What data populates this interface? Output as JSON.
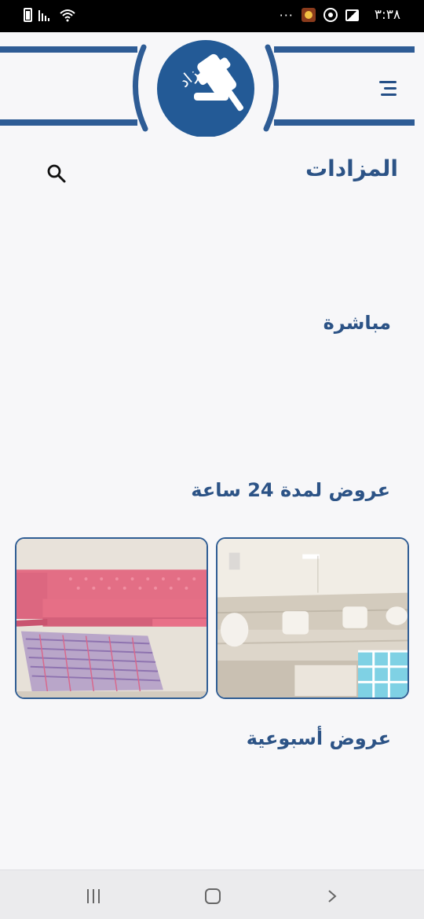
{
  "status_bar": {
    "time": "٣:٣٨",
    "more": "···",
    "icons": [
      "battery-icon",
      "signal-icon",
      "wifi-icon",
      "app-notification-icon",
      "whatsapp-icon",
      "gallery-icon"
    ]
  },
  "header": {
    "logo_text": "مزاد",
    "brand_color": "#2e5c95",
    "icons": [
      "gavel-logo-icon",
      "menu-icon"
    ]
  },
  "page": {
    "title": "المزادات",
    "search_icon": "search-icon"
  },
  "sections": {
    "live": "مباشرة",
    "offers_24h": "عروض لمدة 24 ساعة",
    "weekly": "عروض أسبوعية"
  },
  "cards": [
    {
      "image": "beige-sofa-living-room"
    },
    {
      "image": "pink-sofa-living-room"
    }
  ],
  "nav_bar": {
    "icons": [
      "recent-apps-icon",
      "home-icon",
      "back-icon"
    ]
  }
}
